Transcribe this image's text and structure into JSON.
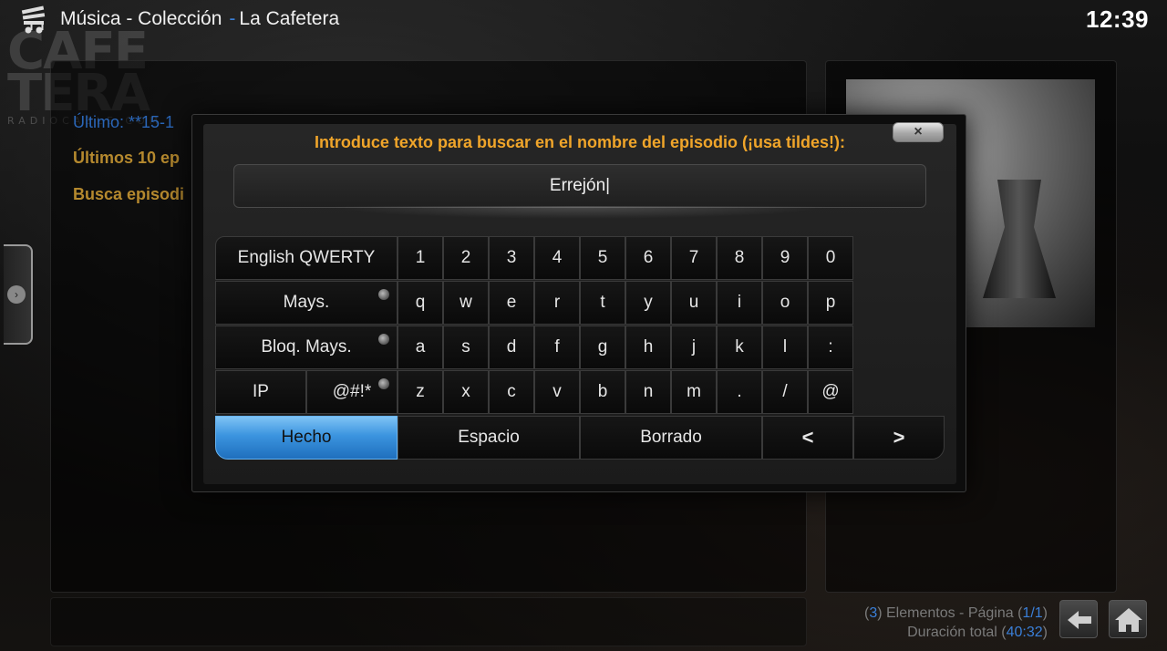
{
  "header": {
    "title_section": "Música - Colección",
    "title_separator": "-",
    "title_addon": "La Cafetera",
    "clock": "12:39"
  },
  "background": {
    "logo_lines": [
      "CAFE",
      "TERA"
    ],
    "logo_sub": "RADIOCABLE.COM",
    "list_items": [
      {
        "label": "Último: **15-1",
        "color": "#2a66b8"
      },
      {
        "label": "Últimos 10 ep",
        "color": "#b5892e"
      },
      {
        "label": "Busca episodi",
        "color": "#b5892e"
      }
    ]
  },
  "dialog": {
    "prompt": "Introduce texto para buscar en el nombre del episodio (¡usa tildes!):",
    "close_label": "×",
    "input_value": "Errejón|"
  },
  "keyboard": {
    "layout_key": "English QWERTY",
    "shift_key": "Mays.",
    "caps_key": "Bloq. Mays.",
    "ip_key": "IP",
    "symbols_key": "@#!*",
    "done_key": "Hecho",
    "space_key": "Espacio",
    "delete_key": "Borrado",
    "left_key": "<",
    "right_key": ">",
    "rows": [
      [
        "1",
        "2",
        "3",
        "4",
        "5",
        "6",
        "7",
        "8",
        "9",
        "0"
      ],
      [
        "q",
        "w",
        "e",
        "r",
        "t",
        "y",
        "u",
        "i",
        "o",
        "p"
      ],
      [
        "a",
        "s",
        "d",
        "f",
        "g",
        "h",
        "j",
        "k",
        "l",
        ":"
      ],
      [
        "z",
        "x",
        "c",
        "v",
        "b",
        "n",
        "m",
        ".",
        "/",
        "@"
      ]
    ]
  },
  "footer": {
    "count_prefix": "(",
    "count": "3",
    "count_suffix": ") Elementos - Página (",
    "page": "1/1",
    "page_suffix": ")",
    "duration_prefix": "Duración total (",
    "duration": "40:32",
    "duration_suffix": ")"
  },
  "colors": {
    "accent": "#3a7fd8",
    "prompt": "#f0a52a",
    "done_key": "#3b94df"
  }
}
